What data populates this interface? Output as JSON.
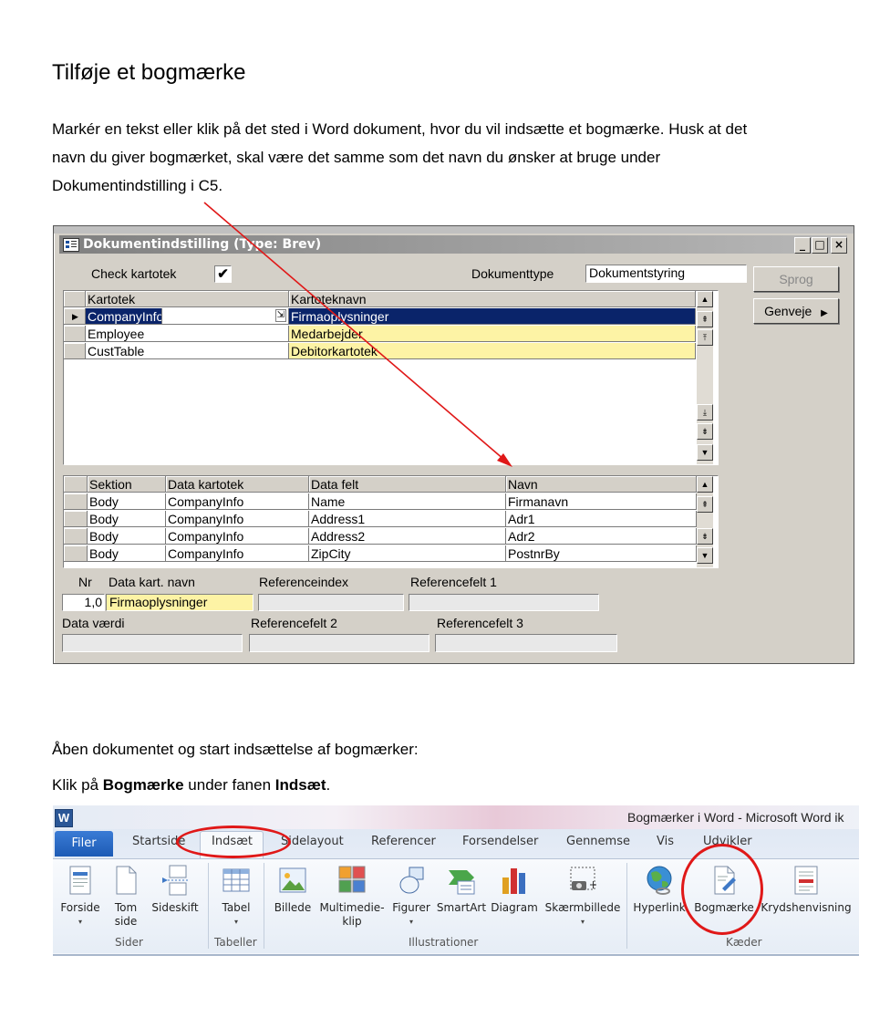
{
  "heading": "Tilføje et bogmærke",
  "intro": {
    "line1": "Markér en tekst eller klik på det sted i Word dokument, hvor du vil indsætte et bogmærke. Husk at det",
    "line2": "navn du giver bogmærket, skal være det samme som det navn du ønsker at bruge under",
    "line3": "Dokumentindstilling i C5."
  },
  "dialog": {
    "title": "Dokumentindstilling (Type: Brev)",
    "check_label": "Check kartotek",
    "check_value": "✔",
    "doctype_label": "Dokumenttype",
    "doctype_value": "Dokumentstyring",
    "sprog_button": "Sprog",
    "genveje_button": "Genveje",
    "kartotek_grid": {
      "headers": [
        "Kartotek",
        "Kartoteknavn"
      ],
      "rows": [
        [
          "CompanyInfo",
          "Firmaoplysninger"
        ],
        [
          "Employee",
          "Medarbejder"
        ],
        [
          "CustTable",
          "Debitorkartotek"
        ]
      ]
    },
    "sektion_grid": {
      "headers": [
        "Sektion",
        "Data kartotek",
        "Data felt",
        "Navn"
      ],
      "rows": [
        [
          "Body",
          "CompanyInfo",
          "Name",
          "Firmanavn"
        ],
        [
          "Body",
          "CompanyInfo",
          "Address1",
          "Adr1"
        ],
        [
          "Body",
          "CompanyInfo",
          "Address2",
          "Adr2"
        ],
        [
          "Body",
          "CompanyInfo",
          "ZipCity",
          "PostnrBy"
        ]
      ]
    },
    "nr_label": "Nr",
    "nr_value": "1,0",
    "datakart_label": "Data kart. navn",
    "datakart_value": "Firmaoplysninger",
    "refindex_label": "Referenceindex",
    "reffelt1_label": "Referencefelt 1",
    "datavaerdi_label": "Data værdi",
    "reffelt2_label": "Referencefelt 2",
    "reffelt3_label": "Referencefelt 3"
  },
  "para2": "Åben dokumentet og start indsættelse af bogmærker:",
  "para3": {
    "pre": "Klik på ",
    "b1": "Bogmærke",
    "mid": " under fanen ",
    "b2": "Indsæt",
    "post": "."
  },
  "word": {
    "logo": "W",
    "window_title": "Bogmærker i Word  -  Microsoft Word ik",
    "tabs": [
      "Filer",
      "Startside",
      "Indsæt",
      "Sidelayout",
      "Referencer",
      "Forsendelser",
      "Gennemse",
      "Vis",
      "Udvikler"
    ],
    "items": {
      "forside": "Forside",
      "tom_side_1": "Tom",
      "tom_side_2": "side",
      "sideskift": "Sideskift",
      "tabel": "Tabel",
      "billede": "Billede",
      "multimedie_1": "Multimedie-",
      "multimedie_2": "klip",
      "figurer": "Figurer",
      "smartart": "SmartArt",
      "diagram": "Diagram",
      "skaermbillede": "Skærmbillede",
      "hyperlink": "Hyperlink",
      "bogmaerke": "Bogmærke",
      "krydshenvisning": "Krydshenvisning"
    },
    "groups": [
      "Sider",
      "Tabeller",
      "Illustrationer",
      "Kæder"
    ],
    "dropdown_glyph": "▾"
  },
  "colors": {
    "annotation_red": "#e01818",
    "selection_blue": "#0a246a",
    "lookup_yellow": "#fdf3a5"
  }
}
